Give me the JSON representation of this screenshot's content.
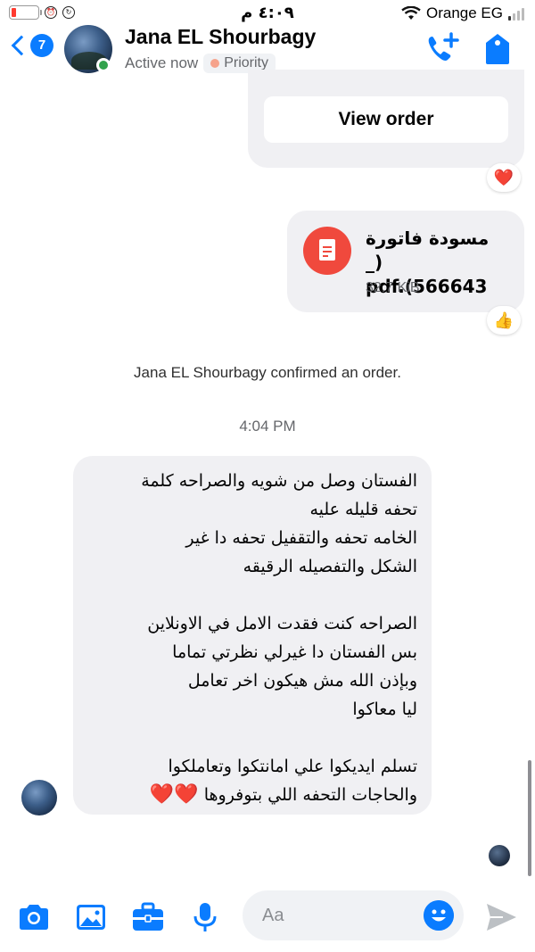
{
  "status_bar": {
    "time": "٤:٠٩ م",
    "carrier": "Orange EG"
  },
  "header": {
    "back_count": "7",
    "contact_name": "Jana EL Shourbagy",
    "active_status": "Active now",
    "priority_label": "Priority"
  },
  "chat": {
    "view_order_label": "View order",
    "reaction_heart": "❤️",
    "file": {
      "name": "مسودة فاتورة (_566643).pdf",
      "name_line1": "مسودة فاتورة (_",
      "name_line2": "pdf.(566643",
      "size": "32.7 KiB"
    },
    "reaction_thumb": "👍",
    "system_message": "Jana EL Shourbagy confirmed an order.",
    "timestamp": "4:04 PM",
    "received_message": {
      "lines": [
        "الفستان وصل من شويه والصراحه كلمة",
        "تحفه قليله عليه",
        "الخامه تحفه والتقفيل تحفه دا غير",
        "الشكل والتفصيله الرقيقه",
        "",
        "الصراحه كنت فقدت الامل في الاونلاين",
        "بس الفستان دا غيرلي نظرتي تماما",
        "وبإذن الله مش هيكون اخر تعامل",
        "ليا معاكوا",
        "",
        "تسلم ايديكوا علي امانتكوا وتعاملكوا",
        "والحاجات التحفه اللي بتوفروها"
      ],
      "hearts": "❤️❤️"
    }
  },
  "composer": {
    "placeholder": "Aa"
  },
  "colors": {
    "accent": "#0a7cff",
    "online": "#31a24c",
    "pdf_red": "#f0493d",
    "bubble_gray": "#f0f0f3"
  }
}
